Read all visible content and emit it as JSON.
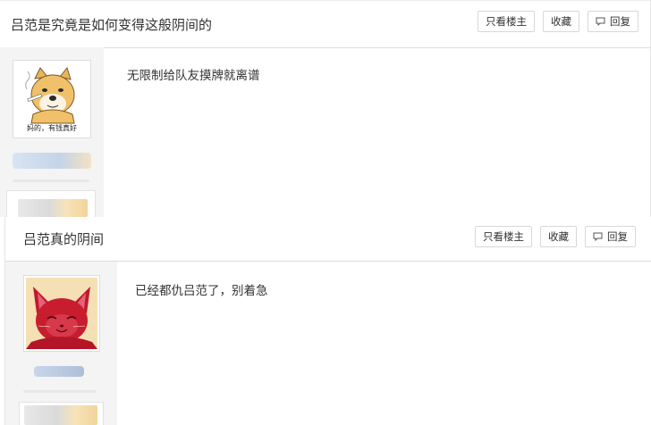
{
  "posts": [
    {
      "title": "吕范是究竟是如何变得这般阴间的",
      "buttons": {
        "only_op": "只看楼主",
        "favorite": "收藏",
        "reply": "回复"
      },
      "content": "无限制给队友摸牌就离谱",
      "avatar_caption": "妈的，有钱真好"
    },
    {
      "title": "吕范真的阴间",
      "buttons": {
        "only_op": "只看楼主",
        "favorite": "收藏",
        "reply": "回复"
      },
      "content": "已经都仇吕范了，别着急"
    }
  ],
  "colors": {
    "border": "#d8d8d8",
    "sidebar_bg": "#f4f4f4",
    "text": "#333333"
  },
  "icons": {
    "reply": "speech-bubble-icon"
  }
}
